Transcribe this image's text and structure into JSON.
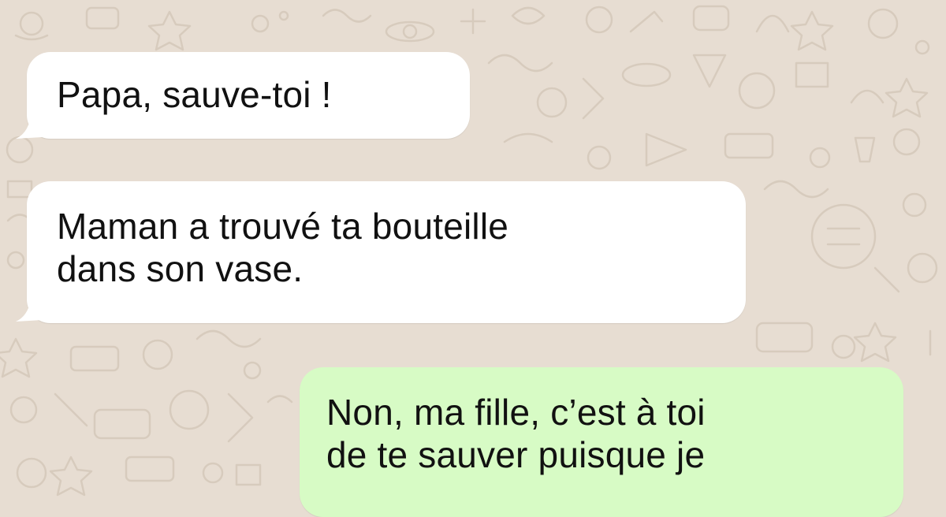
{
  "theme": {
    "background": "#e7ddd2",
    "incoming_bubble": "#ffffff",
    "outgoing_bubble": "#d7fbc5",
    "text": "#111111"
  },
  "messages": [
    {
      "direction": "incoming",
      "lines": [
        "Papa, sauve-toi !"
      ]
    },
    {
      "direction": "incoming",
      "lines": [
        "Maman a trouvé ta bouteille",
        "dans son vase."
      ]
    },
    {
      "direction": "outgoing",
      "lines": [
        "Non, ma fille, c’est à toi",
        "de te sauver puisque je"
      ]
    }
  ]
}
